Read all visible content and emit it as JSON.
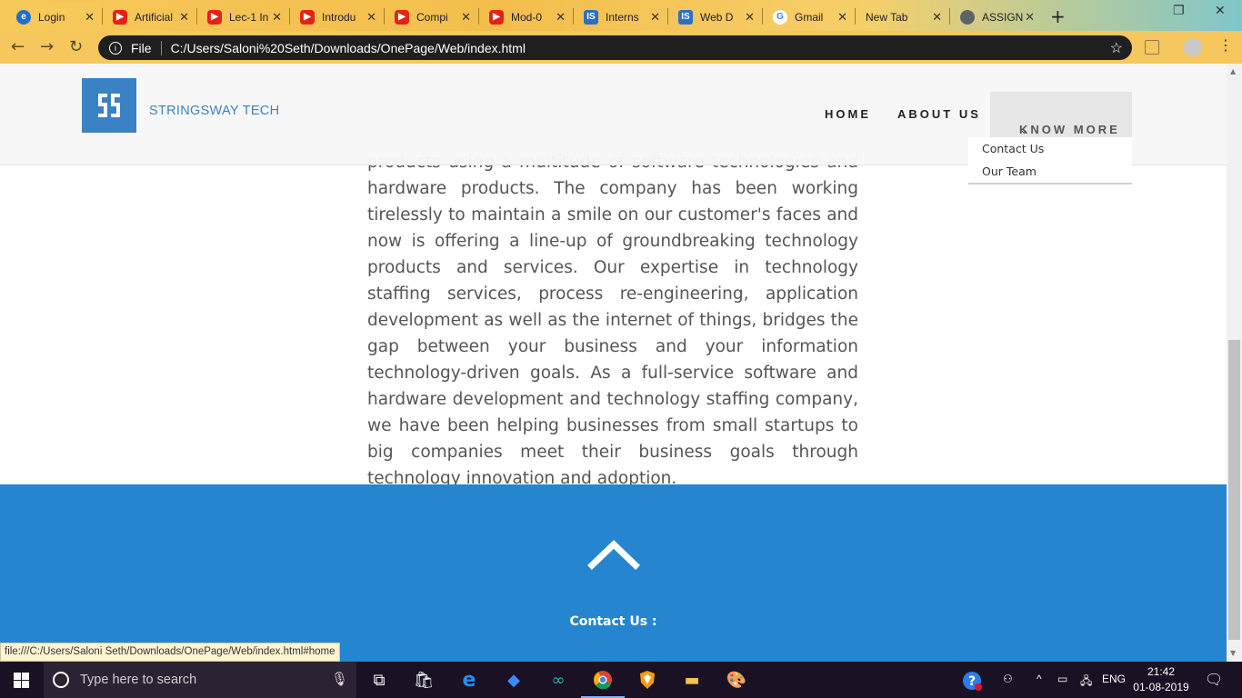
{
  "browser": {
    "tabs": [
      {
        "title": "Login",
        "icon": "edge-icon"
      },
      {
        "title": "Artificial",
        "icon": "youtube-icon"
      },
      {
        "title": "Lec-1 In",
        "icon": "youtube-icon"
      },
      {
        "title": "Introdu",
        "icon": "youtube-icon"
      },
      {
        "title": "Compi",
        "icon": "youtube-icon"
      },
      {
        "title": "Mod-0",
        "icon": "youtube-icon"
      },
      {
        "title": "Interns",
        "icon": "internshala-icon"
      },
      {
        "title": "Web D",
        "icon": "internshala-icon"
      },
      {
        "title": "Gmail",
        "icon": "google-icon"
      },
      {
        "title": "New Tab",
        "icon": ""
      },
      {
        "title": "ASSIGN",
        "icon": "globe-icon"
      }
    ],
    "new_tab_glyph": "+",
    "address_scheme": "File",
    "address_url": "C:/Users/Saloni%20Seth/Downloads/OnePage/Web/index.html",
    "status_url": "file:///C:/Users/Saloni Seth/Downloads/OnePage/Web/index.html#home"
  },
  "site": {
    "brand": "STRINGSWAY TECH",
    "nav": {
      "home": "HOME",
      "about": "ABOUT US",
      "know_more": "KNOW MORE",
      "dropdown": [
        "Contact Us",
        "Our Team"
      ]
    },
    "about_paragraph": "products using a multitude of software technologies and hardware products. The company has been working tirelessly to maintain a smile on our customer's faces and now is offering a line-up of groundbreaking technology products and services. Our expertise in technology staffing services, process re-engineering, application development as well as the internet of things, bridges the gap between your business and your information technology-driven goals. As a full-service software and hardware development and technology staffing company, we have been helping businesses from small startups to big companies meet their business goals through technology innovation and adoption.",
    "footer": {
      "contact_title": "Contact Us :"
    }
  },
  "taskbar": {
    "search_placeholder": "Type here to search",
    "language": "ENG",
    "time": "21:42",
    "date": "01-08-2019"
  },
  "colors": {
    "brand_blue": "#3b82c4",
    "footer_blue": "#2586cf",
    "chrome_theme": "#f6c75c"
  }
}
